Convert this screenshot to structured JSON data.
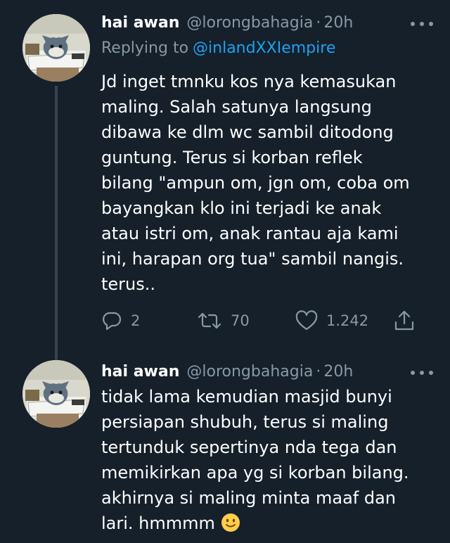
{
  "tweets": [
    {
      "author_name": "hai awan",
      "handle": "@lorongbahagia",
      "separator": "·",
      "time": "20h",
      "replying_label": "Replying to",
      "replying_to": "@inlandXXIempire",
      "text": "Jd inget tmnku kos nya kemasukan\nmaling. Salah satunya langsung\ndibawa ke dlm wc sambil ditodong\nguntung. Terus si korban reflek\nbilang \"ampun om, jgn om, coba om\nbayangkan klo ini terjadi ke anak\natau istri om, anak rantau aja kami\nini, harapan org tua\" sambil nangis.\nterus..",
      "reply_count": "2",
      "retweet_count": "70",
      "like_count": "1.242"
    },
    {
      "author_name": "hai awan",
      "handle": "@lorongbahagia",
      "separator": "·",
      "time": "20h",
      "text": "tidak lama kemudian masjid bunyi\npersiapan shubuh, terus si maling\ntertunduk sepertinya nda tega dan\nmemikirkan apa yg si korban bilang.\nakhirnya si maling minta maaf dan\nlari. hmmmm",
      "emoji": "slightly-smiling-face"
    }
  ],
  "icons": {
    "more": "more-horizontal-icon",
    "reply": "reply-icon",
    "retweet": "retweet-icon",
    "like": "heart-icon",
    "share": "share-icon"
  },
  "colors": {
    "background": "#15202b",
    "secondary_text": "#8899a6",
    "link": "#1da1f2",
    "thread_line": "#38444d"
  }
}
